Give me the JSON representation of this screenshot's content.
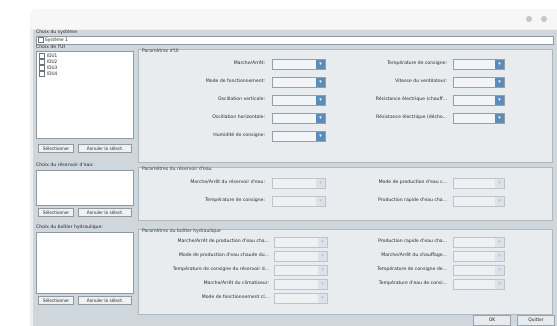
{
  "window": {
    "title_dots": [
      "dot",
      "dot"
    ]
  },
  "system": {
    "label": "Choix du système",
    "value": "Système 1"
  },
  "ui_group": {
    "label": "Choix de l'UI",
    "units": [
      "IDU1",
      "IDU2",
      "IDU3",
      "IDU4"
    ],
    "select_all": "Sélectionner",
    "deselect_all": "Annuler la sélect."
  },
  "ui_params": {
    "title": "Paramètres d'UI",
    "left": [
      {
        "label": "Marche/Arrêt:"
      },
      {
        "label": "Mode de fonctionnement:"
      },
      {
        "label": "Oscillation verticale:"
      },
      {
        "label": "Oscillation horizontale:"
      },
      {
        "label": "Humidité de consigne:"
      }
    ],
    "right": [
      {
        "label": "Température de consigne:"
      },
      {
        "label": "Vitesse du ventilateur:"
      },
      {
        "label": "Résistance électrique (chauff..."
      },
      {
        "label": "Résistance électrique (décho..."
      }
    ]
  },
  "tank_group": {
    "label": "Choix du réservoir d'eau:",
    "select_all": "Sélectionner",
    "deselect_all": "Annuler la sélect."
  },
  "tank_params": {
    "title": "Paramètres du réservoir d'eau",
    "left": [
      {
        "label": "Marche/Arrêt du réservoir d'eau:"
      },
      {
        "label": "Température de consigne:"
      }
    ],
    "right": [
      {
        "label": "Mode de production d'eau c..."
      },
      {
        "label": "Production rapide d'eau cha..."
      }
    ]
  },
  "hydro_group": {
    "label": "Choix du boîtier hydraulique:",
    "select_all": "Sélectionner",
    "deselect_all": "Annuler la sélect."
  },
  "hydro_params": {
    "title": "Paramètres du boîtier hydraulique",
    "left": [
      {
        "label": "Marche/Arrêt de production d'eau cha..."
      },
      {
        "label": "Mode de production d'eau chaude du..."
      },
      {
        "label": "Température de consigne du réservoir d..."
      },
      {
        "label": "Marche/Arrêt du climatiseur:"
      },
      {
        "label": "Mode de fonctionnement cl..."
      }
    ],
    "right": [
      {
        "label": "Production rapide d'eau cha..."
      },
      {
        "label": "Marche/Arrêt du chauffage..."
      },
      {
        "label": "Température de consigne de..."
      },
      {
        "label": "Température d'eau de consi..."
      }
    ]
  },
  "footer": {
    "ok": "OK",
    "cancel": "Quitter"
  }
}
